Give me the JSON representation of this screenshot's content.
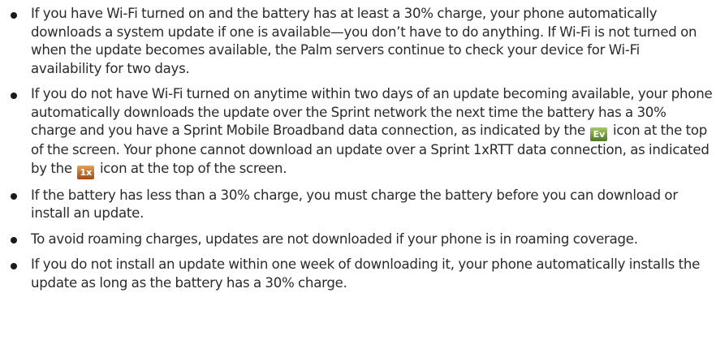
{
  "bullets": [
    {
      "text": "If you have Wi-Fi turned on and the battery has at least a 30% charge, your phone automatically downloads a system update if one is available—you don’t have to do anything. If Wi-Fi is not turned on when the update becomes available, the Palm servers continue to check your device for Wi-Fi availability for two days."
    },
    {
      "text_a": "If you do not have Wi-Fi turned on anytime within two days of an update becoming available, your phone automatically downloads the update over the Sprint network the next time the battery has a 30% charge and you have a Sprint Mobile Broadband data connection, as indicated by the",
      "icon_ev_label": "Ev",
      "text_b": "icon at the top of the screen. Your phone cannot download an update over a Sprint 1xRTT data connection, as indicated by the",
      "icon_1x_label": "1x",
      "text_c": "icon at the top of the screen."
    },
    {
      "text": "If the battery has less than a 30% charge, you must charge the battery before you can download or install an update."
    },
    {
      "text": "To avoid roaming charges, updates are not downloaded if your phone is in roaming coverage."
    },
    {
      "text": "If you do not install an update within one week of downloading it, your phone automatically installs the update as long as the battery has a 30% charge."
    }
  ],
  "icons": {
    "ev_icon": "evdo-network-icon",
    "onex_icon": "1xrtt-network-icon"
  },
  "colors": {
    "text": "#2b2b2b",
    "bullet": "#1a1a1a",
    "ev_icon_bg": "#6f9a35",
    "onex_icon_bg": "#c0692a"
  }
}
